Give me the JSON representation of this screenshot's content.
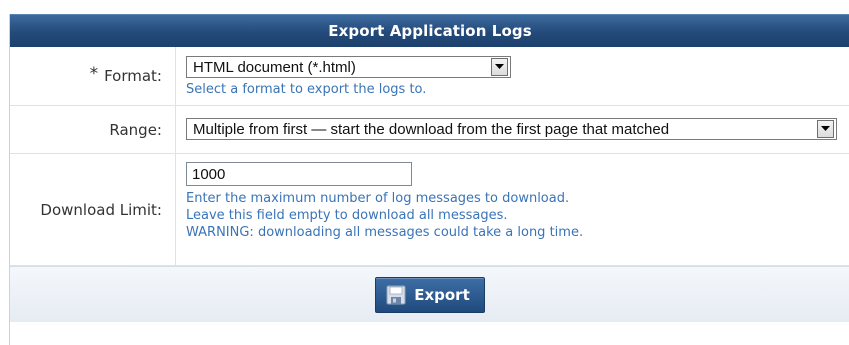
{
  "panel": {
    "title": "Export Application Logs"
  },
  "format": {
    "required_mark": "*",
    "label": "Format:",
    "selected": "HTML document (*.html)",
    "hint": "Select a format to export the logs to."
  },
  "range": {
    "label": "Range:",
    "selected": "Multiple from first — start the download from the first page that matched"
  },
  "download_limit": {
    "label": "Download Limit:",
    "value": "1000",
    "hints": [
      "Enter the maximum number of log messages to download.",
      "Leave this field empty to download all messages.",
      "WARNING: downloading all messages could take a long time."
    ]
  },
  "actions": {
    "export_label": "Export",
    "export_icon": "save-disk-icon"
  },
  "colors": {
    "title_bar": "#234a7a",
    "hint_text": "#3a74b8",
    "button": "#2b5a92"
  }
}
